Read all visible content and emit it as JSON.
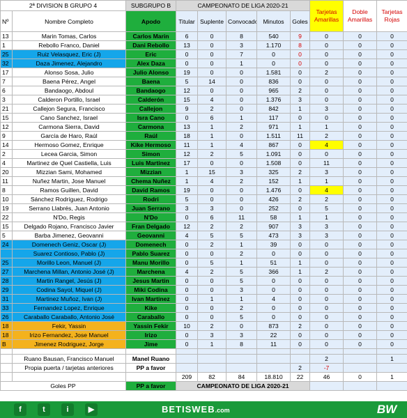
{
  "header": {
    "league": "2ª DIVISION B GRUPO 4",
    "subgroup": "SUBGRUPO B",
    "championship": "CAMPEONATO  DE LIGA 2020-21",
    "cols": {
      "no": "Nº",
      "name": "Nombre Completo",
      "apodo": "Apodo",
      "titular": "Titular",
      "suplente": "Suplente",
      "convocado": "Convocado",
      "minutos": "Minutos",
      "goles": "Goles",
      "amarillas": "Tarjetas Amarillas",
      "doble": "Doble Amarillas",
      "rojas": "Tarjetas Rojas"
    }
  },
  "rows": [
    {
      "no": "13",
      "name": "Marin Tomas, Carlos",
      "apodo": "Carlos Marin",
      "tit": "6",
      "sup": "0",
      "conv": "8",
      "min": "540",
      "gol": "9",
      "am": "0",
      "da": "0",
      "ro": "0",
      "style": "normal",
      "gol_red": true
    },
    {
      "no": "1",
      "name": "Rebollo Franco, Daniel",
      "apodo": "Dani Rebollo",
      "tit": "13",
      "sup": "0",
      "conv": "3",
      "min": "1.170",
      "gol": "8",
      "am": "0",
      "da": "0",
      "ro": "0",
      "style": "normal",
      "gol_red": true
    },
    {
      "no": "25",
      "name": "Ruiz Velasquez, Eric  (J)",
      "apodo": "Eric",
      "tit": "0",
      "sup": "0",
      "conv": "7",
      "min": "0",
      "gol": "0",
      "am": "0",
      "da": "0",
      "ro": "0",
      "style": "blue",
      "gol_red": true
    },
    {
      "no": "32",
      "name": "Daza Jimenez, Alejandro",
      "apodo": "Alex Daza",
      "tit": "0",
      "sup": "0",
      "conv": "1",
      "min": "0",
      "gol": "0",
      "am": "0",
      "da": "0",
      "ro": "0",
      "style": "blue",
      "gol_red": true
    },
    {
      "no": "17",
      "name": "Alonso Sosa, Julio",
      "apodo": "Julio Alonso",
      "tit": "19",
      "sup": "0",
      "conv": "0",
      "min": "1.581",
      "gol": "0",
      "am": "2",
      "da": "0",
      "ro": "0",
      "style": "normal"
    },
    {
      "no": "7",
      "name": "Baena Pérez, Angel",
      "apodo": "Baena",
      "tit": "5",
      "sup": "14",
      "conv": "0",
      "min": "836",
      "gol": "0",
      "am": "0",
      "da": "0",
      "ro": "0",
      "style": "normal"
    },
    {
      "no": "6",
      "name": "Bandaogo, Abdoul",
      "apodo": "Bandaogo",
      "tit": "12",
      "sup": "0",
      "conv": "0",
      "min": "965",
      "gol": "2",
      "am": "0",
      "da": "0",
      "ro": "0",
      "style": "normal"
    },
    {
      "no": "3",
      "name": "Calderon Portillo, Israel",
      "apodo": "Calderón",
      "tit": "15",
      "sup": "4",
      "conv": "0",
      "min": "1.376",
      "gol": "3",
      "am": "0",
      "da": "0",
      "ro": "0",
      "style": "normal"
    },
    {
      "no": "21",
      "name": "Callejon Segura, Francisco",
      "apodo": "Callejon",
      "tit": "9",
      "sup": "2",
      "conv": "0",
      "min": "842",
      "gol": "1",
      "am": "3",
      "da": "0",
      "ro": "0",
      "style": "normal"
    },
    {
      "no": "15",
      "name": "Cano Sanchez, Israel",
      "apodo": "Isra Cano",
      "tit": "0",
      "sup": "6",
      "conv": "1",
      "min": "117",
      "gol": "0",
      "am": "0",
      "da": "0",
      "ro": "0",
      "style": "normal"
    },
    {
      "no": "12",
      "name": "Carmona Sierra, David",
      "apodo": "Carmona",
      "tit": "13",
      "sup": "1",
      "conv": "2",
      "min": "971",
      "gol": "1",
      "am": "1",
      "da": "0",
      "ro": "0",
      "style": "normal"
    },
    {
      "no": "9",
      "name": "García de Haro, Raúl",
      "apodo": "Raúl",
      "tit": "18",
      "sup": "1",
      "conv": "0",
      "min": "1.511",
      "gol": "11",
      "am": "2",
      "da": "0",
      "ro": "0",
      "style": "normal"
    },
    {
      "no": "14",
      "name": "Hermoso Gomez, Enrique",
      "apodo": "Kike Hermoso",
      "tit": "11",
      "sup": "1",
      "conv": "4",
      "min": "867",
      "gol": "0",
      "am": "4",
      "da": "0",
      "ro": "0",
      "style": "normal",
      "am_yellow": true
    },
    {
      "no": "2",
      "name": "Lecea Garcia, Simon",
      "apodo": "Simon",
      "tit": "12",
      "sup": "2",
      "conv": "5",
      "min": "1.091",
      "gol": "0",
      "am": "0",
      "da": "0",
      "ro": "0",
      "style": "normal"
    },
    {
      "no": "4",
      "name": "Martinez de Quel Castiella, Luis",
      "apodo": "Luis Martinez",
      "tit": "17",
      "sup": "0",
      "conv": "0",
      "min": "1.508",
      "gol": "0",
      "am": "11",
      "da": "0",
      "ro": "0",
      "style": "normal"
    },
    {
      "no": "20",
      "name": "Mizzian Sami, Mohamed",
      "apodo": "Mizzian",
      "tit": "1",
      "sup": "15",
      "conv": "3",
      "min": "325",
      "gol": "2",
      "am": "3",
      "da": "0",
      "ro": "0",
      "style": "normal"
    },
    {
      "no": "11",
      "name": "Nuñez Martin, Jose Manuel",
      "apodo": "Chema Nuñez",
      "tit": "1",
      "sup": "4",
      "conv": "2",
      "min": "152",
      "gol": "1",
      "am": "1",
      "da": "0",
      "ro": "0",
      "style": "normal"
    },
    {
      "no": "8",
      "name": "Ramos Guillen, David",
      "apodo": "David Ramos",
      "tit": "19",
      "sup": "0",
      "conv": "0",
      "min": "1.476",
      "gol": "0",
      "am": "4",
      "da": "0",
      "ro": "0",
      "style": "normal",
      "am_yellow": true
    },
    {
      "no": "10",
      "name": "Sánchez Rodríguez, Rodrigo",
      "apodo": "Rodri",
      "tit": "5",
      "sup": "0",
      "conv": "0",
      "min": "426",
      "gol": "2",
      "am": "2",
      "da": "0",
      "ro": "0",
      "style": "normal"
    },
    {
      "no": "19",
      "name": "Serrano Llabrés, Juan Antonio",
      "apodo": "Juan Serrano",
      "tit": "3",
      "sup": "3",
      "conv": "0",
      "min": "252",
      "gol": "0",
      "am": "5",
      "da": "0",
      "ro": "0",
      "style": "normal"
    },
    {
      "no": "22",
      "name": "N'Do, Regis",
      "apodo": "N'Do",
      "tit": "0",
      "sup": "6",
      "conv": "11",
      "min": "58",
      "gol": "1",
      "am": "1",
      "da": "0",
      "ro": "0",
      "style": "normal"
    },
    {
      "no": "15",
      "name": "Delgado Rojano, Francisco Javier",
      "apodo": "Fran Delgado",
      "tit": "12",
      "sup": "2",
      "conv": "2",
      "min": "907",
      "gol": "3",
      "am": "3",
      "da": "0",
      "ro": "0",
      "style": "normal"
    },
    {
      "no": "5",
      "name": "Barba Jimenez, Geovanni",
      "apodo": "Geovanni",
      "tit": "4",
      "sup": "5",
      "conv": "5",
      "min": "473",
      "gol": "3",
      "am": "3",
      "da": "0",
      "ro": "0",
      "style": "normal"
    },
    {
      "no": "24",
      "name": "Domenech Geniz, Oscar (J)",
      "apodo": "Domenech",
      "tit": "0",
      "sup": "2",
      "conv": "1",
      "min": "39",
      "gol": "0",
      "am": "0",
      "da": "0",
      "ro": "0",
      "style": "blue"
    },
    {
      "no": "",
      "name": "Suarez Contioso, Pablo (J)",
      "apodo": "Pablo Suarez",
      "tit": "0",
      "sup": "0",
      "conv": "2",
      "min": "0",
      "gol": "0",
      "am": "0",
      "da": "0",
      "ro": "0",
      "style": "blue"
    },
    {
      "no": "25",
      "name": "Morillo Leon, Manuel (J)",
      "apodo": "Manu Morillo",
      "tit": "0",
      "sup": "5",
      "conv": "1",
      "min": "51",
      "gol": "1",
      "am": "0",
      "da": "0",
      "ro": "0",
      "style": "blue"
    },
    {
      "no": "27",
      "name": "Marchena Millan, Antonio José (J)",
      "apodo": "Marchena",
      "tit": "4",
      "sup": "2",
      "conv": "5",
      "min": "366",
      "gol": "1",
      "am": "2",
      "da": "0",
      "ro": "0",
      "style": "blue"
    },
    {
      "no": "28",
      "name": "Martin Rangel, Jesús (J)",
      "apodo": "Jesus Martin",
      "tit": "0",
      "sup": "0",
      "conv": "5",
      "min": "0",
      "gol": "0",
      "am": "0",
      "da": "0",
      "ro": "0",
      "style": "blue"
    },
    {
      "no": "29",
      "name": "Codina Sayol, Miquel (J)",
      "apodo": "Miki Codina",
      "tit": "0",
      "sup": "0",
      "conv": "3",
      "min": "0",
      "gol": "0",
      "am": "0",
      "da": "0",
      "ro": "0",
      "style": "blue"
    },
    {
      "no": "31",
      "name": "Martinez Muñoz, Ivan (J)",
      "apodo": "Ivan Martinez",
      "tit": "0",
      "sup": "1",
      "conv": "1",
      "min": "4",
      "gol": "0",
      "am": "0",
      "da": "0",
      "ro": "0",
      "style": "blue"
    },
    {
      "no": "33",
      "name": "Fernandez Lopez, Enrique",
      "apodo": "Kike",
      "tit": "0",
      "sup": "0",
      "conv": "2",
      "min": "0",
      "gol": "0",
      "am": "0",
      "da": "0",
      "ro": "0",
      "style": "blue"
    },
    {
      "no": "26",
      "name": "Caraballo Caraballo, Antonio José",
      "apodo": "Caraballo",
      "tit": "0",
      "sup": "0",
      "conv": "5",
      "min": "0",
      "gol": "0",
      "am": "0",
      "da": "0",
      "ro": "0",
      "style": "blue"
    },
    {
      "no": "18",
      "name": "Fekir, Yassin",
      "apodo": "Yassin Fekir",
      "tit": "10",
      "sup": "2",
      "conv": "0",
      "min": "873",
      "gol": "2",
      "am": "0",
      "da": "0",
      "ro": "0",
      "style": "orange"
    },
    {
      "no": "18",
      "name": "Irizo Fernandez, Jose Manuel",
      "apodo": "Irizo",
      "tit": "0",
      "sup": "3",
      "conv": "3",
      "min": "22",
      "gol": "0",
      "am": "0",
      "da": "0",
      "ro": "0",
      "style": "orange"
    },
    {
      "no": "B",
      "name": "Jimenez Rodriguez, Jorge",
      "apodo": "Jime",
      "tit": "0",
      "sup": "1",
      "conv": "8",
      "min": "11",
      "gol": "0",
      "am": "0",
      "da": "0",
      "ro": "0",
      "style": "orange"
    }
  ],
  "extra": {
    "ruano_name": "Ruano Bausan, Francisco Manuel",
    "ruano_apodo": "Manel Ruano",
    "ruano_am": "2",
    "ruano_ro": "1",
    "pp_name": "Propia puerta / tarjetas anteriores",
    "pp_apodo": "PP a favor",
    "pp_gol": "2",
    "pp_am": "-7"
  },
  "totals": {
    "tit": "209",
    "sup": "82",
    "conv": "84",
    "min": "18.810",
    "gol": "22",
    "am": "46",
    "da": "0",
    "ro": "1"
  },
  "footer_row": {
    "label": "Goles PP",
    "apodo": "PP a favor",
    "title": "CAMPEONATO  DE LIGA 2020-21"
  },
  "banner": {
    "social": [
      "f",
      "t",
      "i",
      "▶"
    ],
    "brand": "BETISWEB",
    "brand_suffix": ".com",
    "logo": "BW"
  },
  "colors": {
    "green": "#1fae3d",
    "blue": "#15a6ea",
    "orange": "#f4b21d",
    "yellow": "#ffff00",
    "red_text": "#d40000",
    "banner": "#1a9a3a"
  }
}
